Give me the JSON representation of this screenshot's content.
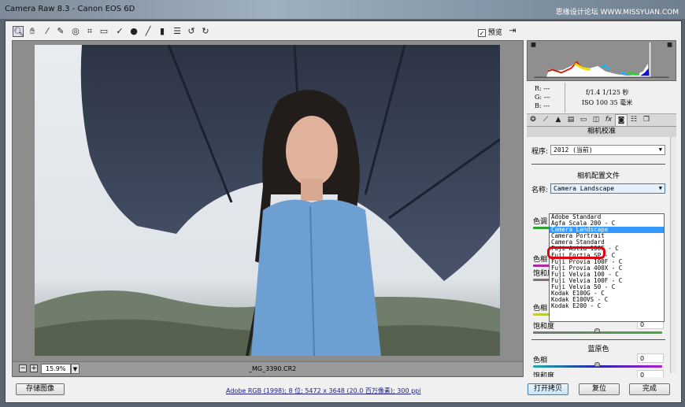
{
  "window": {
    "title": "Camera Raw 8.3 -  Canon EOS 6D",
    "watermark": "思缘设计论坛 WWW.MISSYUAN.COM"
  },
  "toolbar": {
    "tools": [
      "zoom-icon",
      "hand-icon",
      "white-balance-icon",
      "color-sampler-icon",
      "target-adjust-icon",
      "crop-icon",
      "straighten-icon",
      "spot-removal-icon",
      "red-eye-icon",
      "adjustment-brush-icon",
      "graduated-filter-icon",
      "presets-list-icon",
      "rotate-left-icon",
      "rotate-right-icon"
    ],
    "preview_label": "预览",
    "preview_checked": true
  },
  "preview": {
    "zoom": "15.9%",
    "filename": "_MG_3390.CR2"
  },
  "info": {
    "r": "R:  ---",
    "g": "G:  ---",
    "b": "B:  ---",
    "aperture_shutter": "f/1.4   1/125 秒",
    "iso_focal": "ISO 100   35 毫米"
  },
  "panel": {
    "title": "相机校准",
    "process_label": "程序:",
    "process_value": "2012 (当前)",
    "profile_section": "相机配置文件",
    "name_label": "名称:",
    "name_value": "Camera Landscape",
    "profile_options": [
      "Adobe Standard",
      "Agfa Scala 200 - C",
      "Camera Landscape",
      "Camera Portrait",
      "Camera Standard",
      "Fuji Astia 100F - C",
      "Fuji Fortia SP - C",
      "Fuji Provia 100F - C",
      "Fuji Provia 400X - C",
      "Fuji Velvia 100 - C",
      "Fuji Velvia 100F - C",
      "Fuji Velvia 50 - C",
      "Kodak E100G - C",
      "Kodak E100VS - C",
      "Kodak E200 - C"
    ],
    "selected_option": "Camera Landscape",
    "partial_labels": {
      "tint": "色调",
      "hue1": "色相",
      "sat1": "饱和度"
    },
    "green": {
      "hue_label": "色相",
      "hue": "0",
      "sat_label": "饱和度",
      "sat": "0"
    },
    "blue": {
      "section": "蓝原色",
      "hue_label": "色相",
      "hue": "0",
      "sat_label": "饱和度",
      "sat": "0"
    }
  },
  "footer": {
    "save_label": "存储图像",
    "workflow_info": "Adobe RGB (1998); 8 位; 5472 x 3648 (20.0 百万像素); 300 ppi",
    "open_label": "打开拷贝",
    "reset_label": "复位",
    "done_label": "完成"
  },
  "colors": {
    "selection": "#3399ff",
    "annotation": "#e00010",
    "link": "#1b1b8a"
  }
}
